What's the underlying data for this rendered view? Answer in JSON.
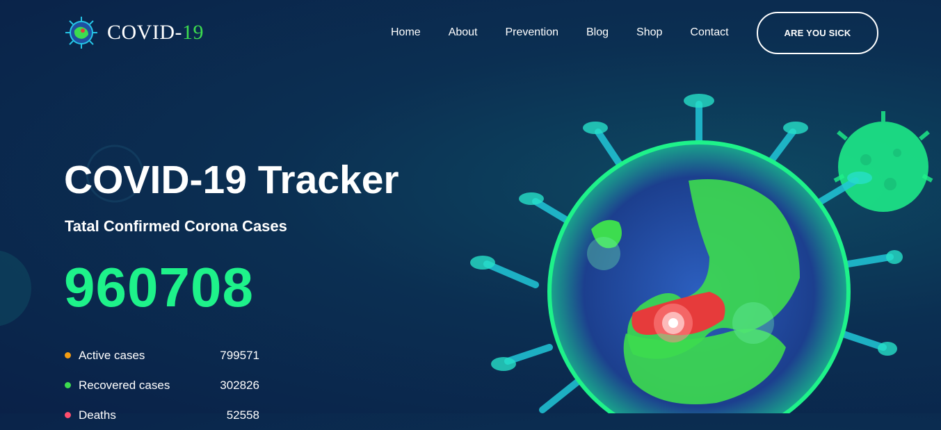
{
  "brand": {
    "name_main": "COVID-",
    "name_accent": "19"
  },
  "nav": {
    "items": [
      {
        "label": "Home"
      },
      {
        "label": "About"
      },
      {
        "label": "Prevention"
      },
      {
        "label": "Blog"
      },
      {
        "label": "Shop"
      },
      {
        "label": "Contact"
      }
    ],
    "cta_label": "ARE YOU SICK"
  },
  "hero": {
    "title": "COVID-19 Tracker",
    "subtitle": "Tatal Confirmed Corona Cases",
    "total": "960708"
  },
  "stats": [
    {
      "label": "Active cases",
      "value": "799571",
      "color": "#f39c12"
    },
    {
      "label": "Recovered cases",
      "value": "302826",
      "color": "#3ddc4f"
    },
    {
      "label": "Deaths",
      "value": "52558",
      "color": "#ff4d6d"
    }
  ],
  "colors": {
    "background": "#0b2f52",
    "accent_green": "#1ef28a",
    "brand_green": "#3ddc4f"
  },
  "icons": [
    "virus-globe-logo-icon",
    "virus-globe-illustration"
  ]
}
